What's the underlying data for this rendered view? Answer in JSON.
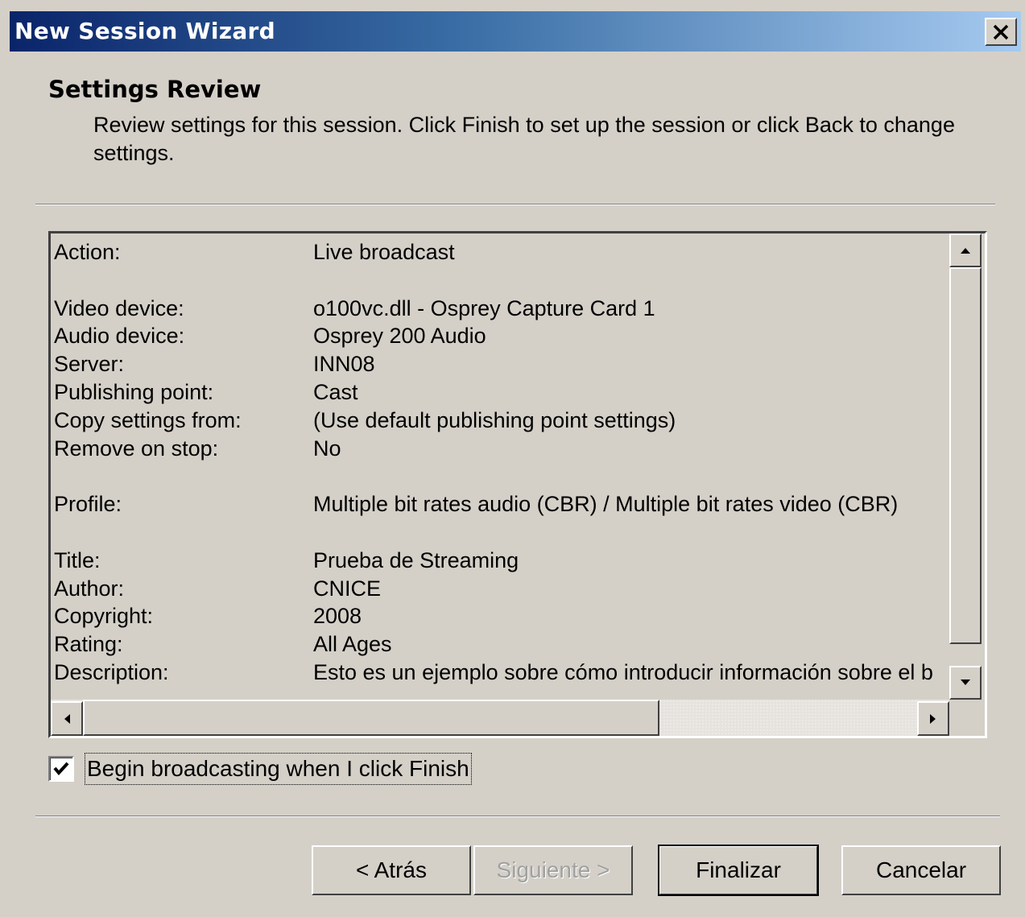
{
  "window": {
    "title": "New Session Wizard",
    "close_symbol": "✕"
  },
  "header": {
    "title": "Settings Review",
    "description": "Review settings for this session. Click Finish to set up the session or click Back to change settings."
  },
  "settings": [
    {
      "label": "Action:",
      "value": "Live broadcast"
    },
    {
      "label": "",
      "value": ""
    },
    {
      "label": "Video device:",
      "value": "o100vc.dll - Osprey Capture Card 1"
    },
    {
      "label": "Audio device:",
      "value": "Osprey 200 Audio"
    },
    {
      "label": "Server:",
      "value": "INN08"
    },
    {
      "label": "Publishing point:",
      "value": "Cast"
    },
    {
      "label": "Copy settings from:",
      "value": "(Use default publishing point settings)"
    },
    {
      "label": "Remove on stop:",
      "value": "No"
    },
    {
      "label": "",
      "value": ""
    },
    {
      "label": "Profile:",
      "value": "Multiple bit rates audio (CBR) / Multiple bit rates video (CBR)"
    },
    {
      "label": "",
      "value": ""
    },
    {
      "label": "Title:",
      "value": "Prueba de Streaming"
    },
    {
      "label": "Author:",
      "value": "CNICE"
    },
    {
      "label": "Copyright:",
      "value": "2008"
    },
    {
      "label": "Rating:",
      "value": "All Ages"
    },
    {
      "label": "Description:",
      "value": "Esto es un ejemplo sobre cómo introducir información sobre el b"
    }
  ],
  "scrollbars": {
    "up_icon": "arrow-up-icon",
    "down_icon": "arrow-down-icon",
    "left_icon": "arrow-left-icon",
    "right_icon": "arrow-right-icon"
  },
  "checkbox": {
    "label": "Begin broadcasting when I click Finish",
    "checked": true
  },
  "buttons": {
    "back": "< Atrás",
    "next": "Siguiente >",
    "finish": "Finalizar",
    "cancel": "Cancelar"
  },
  "colors": {
    "title_start": "#0a246a",
    "title_end": "#a6caf0",
    "face": "#d4d0c8"
  }
}
